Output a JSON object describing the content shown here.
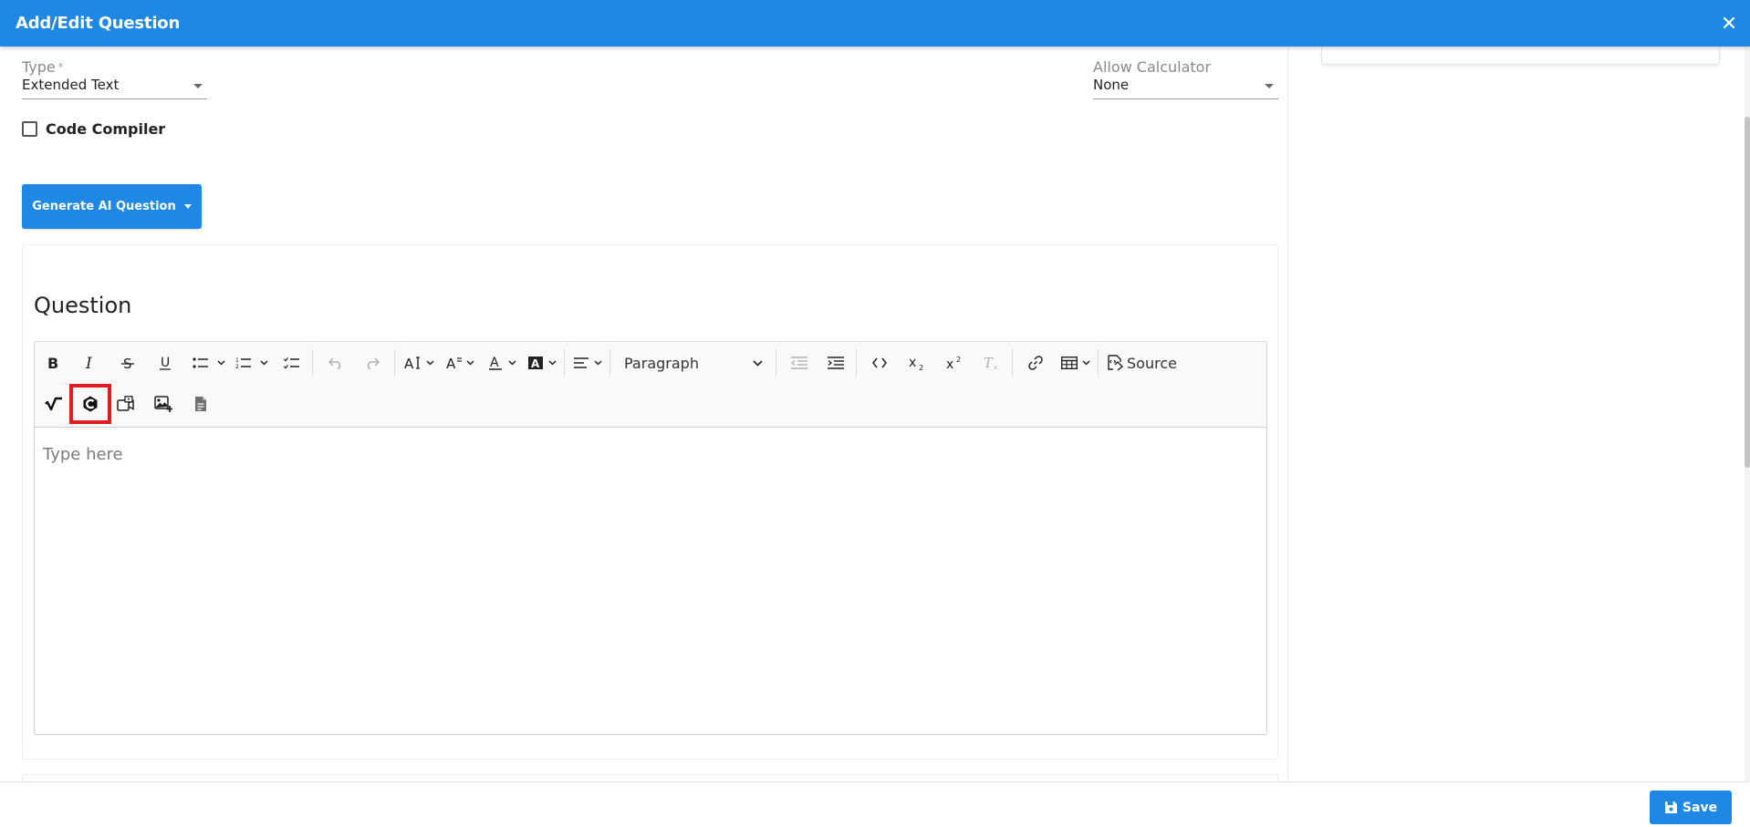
{
  "header": {
    "title": "Add/Edit Question"
  },
  "form": {
    "type": {
      "label": "Type",
      "required_mark": "*",
      "value": "Extended Text"
    },
    "allow_calculator": {
      "label": "Allow Calculator",
      "value": "None"
    },
    "code_compiler": {
      "label": "Code Compiler",
      "checked": false
    },
    "generate_ai_button": {
      "label": "Generate AI Question"
    }
  },
  "question_card": {
    "title": "Question",
    "toolbar": {
      "block_format": "Paragraph",
      "source_label": "Source",
      "colors": {
        "highlight_outline": "#e01b22"
      }
    },
    "editor": {
      "placeholder": "Type here"
    }
  },
  "footer": {
    "save_label": "Save"
  },
  "colors": {
    "primary": "#1f88e5"
  }
}
